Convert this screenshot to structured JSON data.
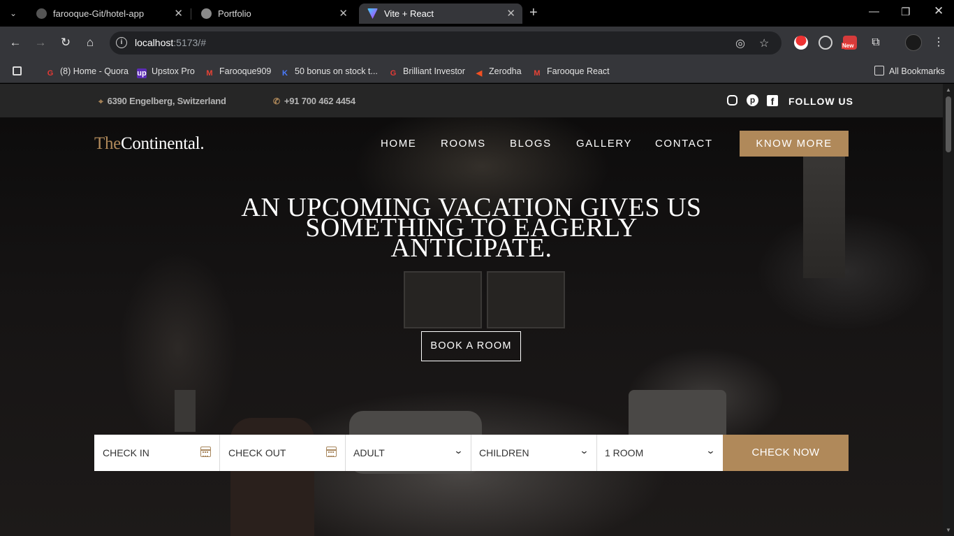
{
  "browser": {
    "tabs": [
      {
        "title": "farooque-Git/hotel-app",
        "icon": "github-icon"
      },
      {
        "title": "Portfolio",
        "icon": "globe-icon"
      },
      {
        "title": "Vite + React",
        "icon": "vite-icon"
      }
    ],
    "url": {
      "host": "localhost",
      "rest": ":5173/#"
    },
    "bookmarks": [
      {
        "label": "(8) Home - Quora"
      },
      {
        "label": "Upstox Pro"
      },
      {
        "label": "Farooque909"
      },
      {
        "label": "50 bonus on stock t..."
      },
      {
        "label": "Brilliant Investor"
      },
      {
        "label": "Zerodha"
      },
      {
        "label": "Farooque React"
      }
    ],
    "all_bookmarks": "All Bookmarks",
    "ext_badge": "New"
  },
  "site": {
    "topbar": {
      "address": "6390 Engelberg, Switzerland",
      "phone": "+91 700 462 4454",
      "follow": "FOLLOW US"
    },
    "logo": {
      "prefix": "The",
      "name": "Continental."
    },
    "nav": [
      "HOME",
      "ROOMS",
      "BLOGS",
      "GALLERY",
      "CONTACT"
    ],
    "cta": "KNOW MORE",
    "hero": {
      "headline": [
        "AN UPCOMING VACATION GIVES US",
        "SOMETHING TO EAGERLY",
        "ANTICIPATE."
      ],
      "button": "BOOK A ROOM"
    },
    "booking": {
      "check_in": "CHECK IN",
      "check_out": "CHECK OUT",
      "adult": "ADULT",
      "children": "CHILDREN",
      "rooms": "1 ROOM",
      "submit": "CHECK NOW"
    }
  },
  "colors": {
    "accent": "#b0895a",
    "topbar": "#262626"
  }
}
